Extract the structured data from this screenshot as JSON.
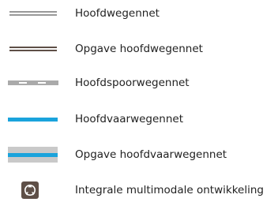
{
  "legend": {
    "items": [
      {
        "label": "Hoofdwegennet",
        "symbol": "grey-double-line-icon"
      },
      {
        "label": "Opgave hoofdwegennet",
        "symbol": "brown-double-line-icon"
      },
      {
        "label": "Hoofdspoorwegennet",
        "symbol": "dashed-rail-line-icon"
      },
      {
        "label": "Hoofdvaarwegennet",
        "symbol": "blue-waterway-line-icon"
      },
      {
        "label": "Opgave hoofdvaarwegennet",
        "symbol": "blue-line-on-grey-band-icon"
      },
      {
        "label": "Integrale multimodale ontwikkeling",
        "symbol": "multimodal-development-icon"
      }
    ],
    "colors": {
      "road": "#999999",
      "road_task": "#5e4f47",
      "rail": "#aaaaaa",
      "water": "#1aa3dc",
      "water_task_band": "#c9c9c9",
      "icon_fill": "#5e4f47"
    }
  }
}
